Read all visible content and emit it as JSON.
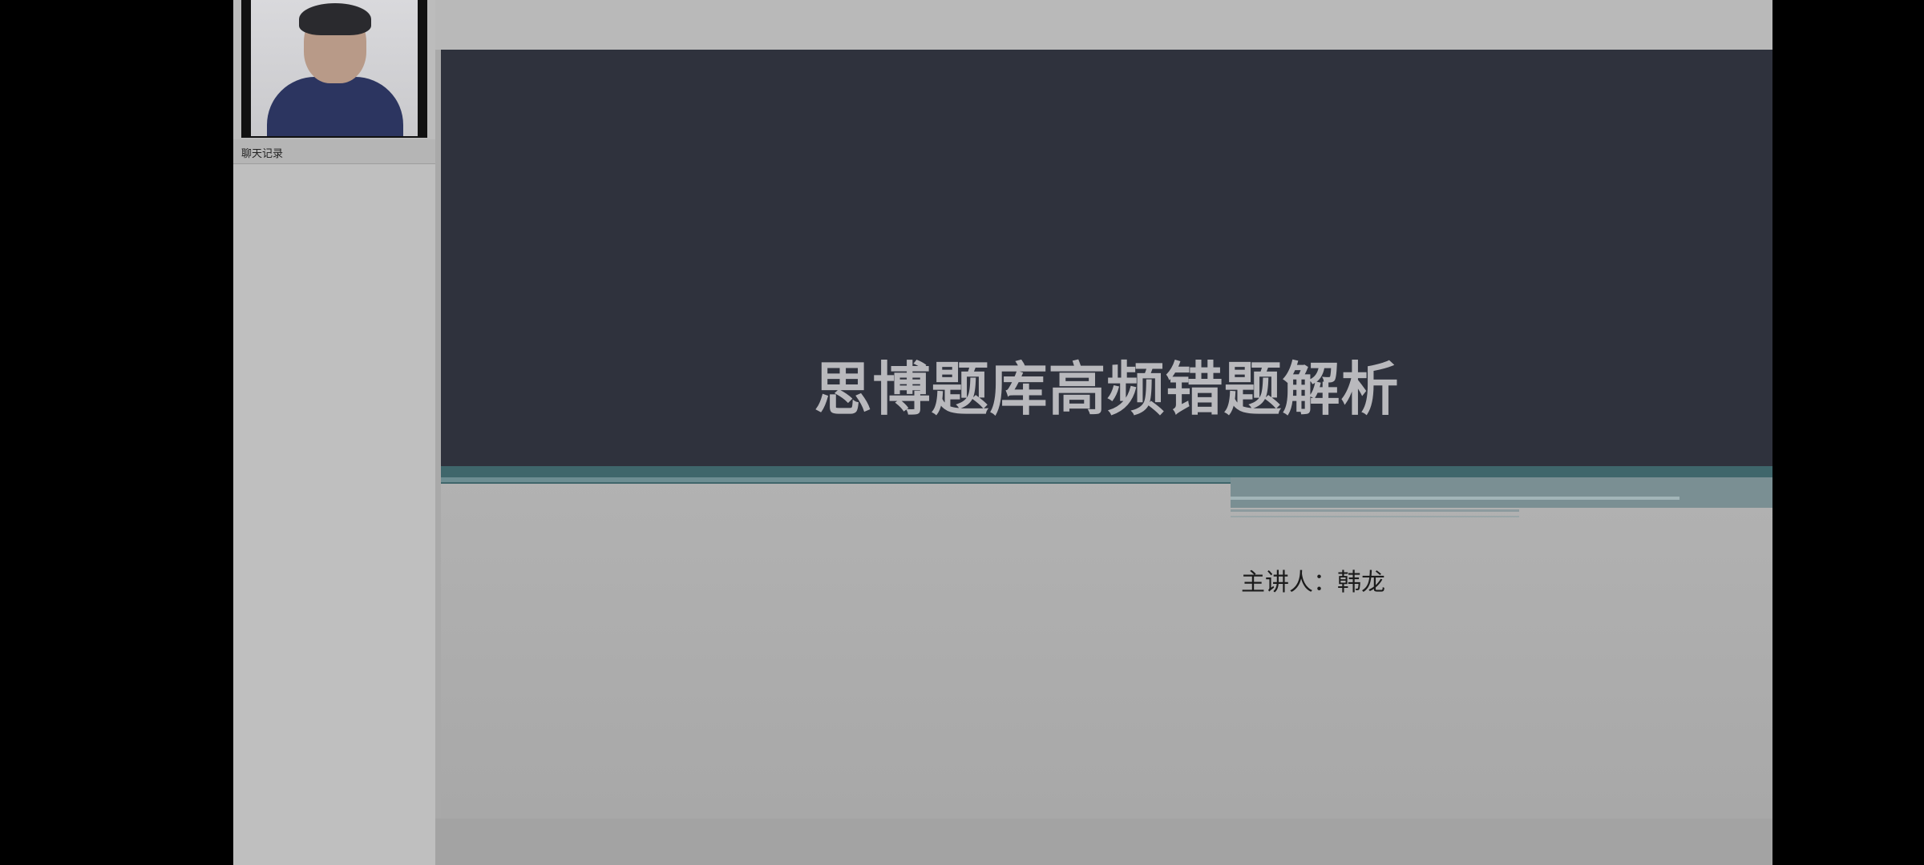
{
  "sidebar": {
    "chat_tab_label": "聊天记录"
  },
  "slide": {
    "title": "思博题库高频错题解析",
    "presenter": "主讲人：韩龙"
  }
}
